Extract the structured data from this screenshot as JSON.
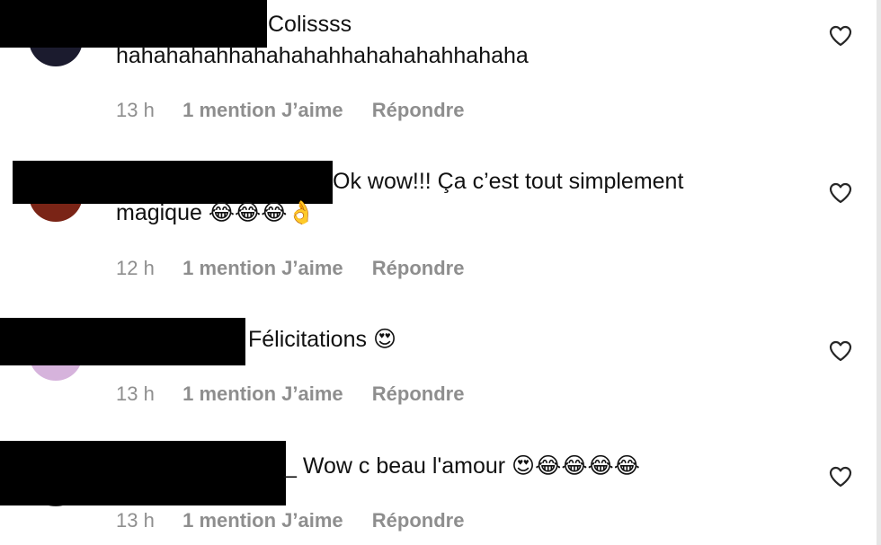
{
  "comments": [
    {
      "text_lines": [
        "Colissss",
        "hahahahahhahahahahhahahahahhahaha"
      ],
      "time": "13 h",
      "likes": "1 mention J’aime",
      "reply": "Répondre",
      "avatar_color": "#1b1b2e"
    },
    {
      "text_lines": [
        "Ok wow!!! Ça c’est tout simplement",
        "magique 😂😂😂👌"
      ],
      "time": "12 h",
      "likes": "1 mention J’aime",
      "reply": "Répondre",
      "avatar_color": "#7a2416"
    },
    {
      "text_lines": [
        "Félicitations 😍"
      ],
      "time": "13 h",
      "likes": "1 mention J’aime",
      "reply": "Répondre",
      "avatar_color": "#d6b3dc"
    },
    {
      "text_lines": [
        "_ Wow c beau l'amour 😍😂😂😂😂"
      ],
      "time": "13 h",
      "likes": "1 mention J’aime",
      "reply": "Répondre",
      "avatar_color": "#333333"
    }
  ],
  "colors": {
    "meta_text": "#8e8e8e",
    "body_text": "#111111",
    "redaction": "#000000"
  }
}
